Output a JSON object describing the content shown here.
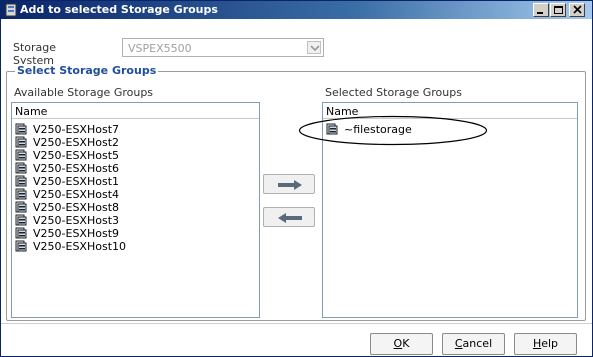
{
  "window": {
    "title": "Add to selected Storage Groups"
  },
  "storage_system": {
    "label": "Storage System",
    "value": "VSPEX5500"
  },
  "group": {
    "title": "Select Storage Groups"
  },
  "available": {
    "label": "Available Storage Groups",
    "header": "Name",
    "items": [
      "V250-ESXHost7",
      "V250-ESXHost2",
      "V250-ESXHost5",
      "V250-ESXHost6",
      "V250-ESXHost1",
      "V250-ESXHost4",
      "V250-ESXHost8",
      "V250-ESXHost3",
      "V250-ESXHost9",
      "V250-ESXHost10"
    ]
  },
  "selected": {
    "label": "Selected Storage Groups",
    "header": "Name",
    "items": [
      "~filestorage"
    ]
  },
  "buttons": {
    "ok_first": "O",
    "ok_rest": "K",
    "cancel_first": "C",
    "cancel_rest": "ancel",
    "help_first": "H",
    "help_rest": "elp"
  },
  "icons": {
    "app": "storage-app-icon",
    "item": "storage-group-icon",
    "add": "right-arrow-icon",
    "remove": "left-arrow-icon"
  },
  "colors": {
    "title_bar": "#0a246a",
    "group_title": "#1f4e9c"
  }
}
